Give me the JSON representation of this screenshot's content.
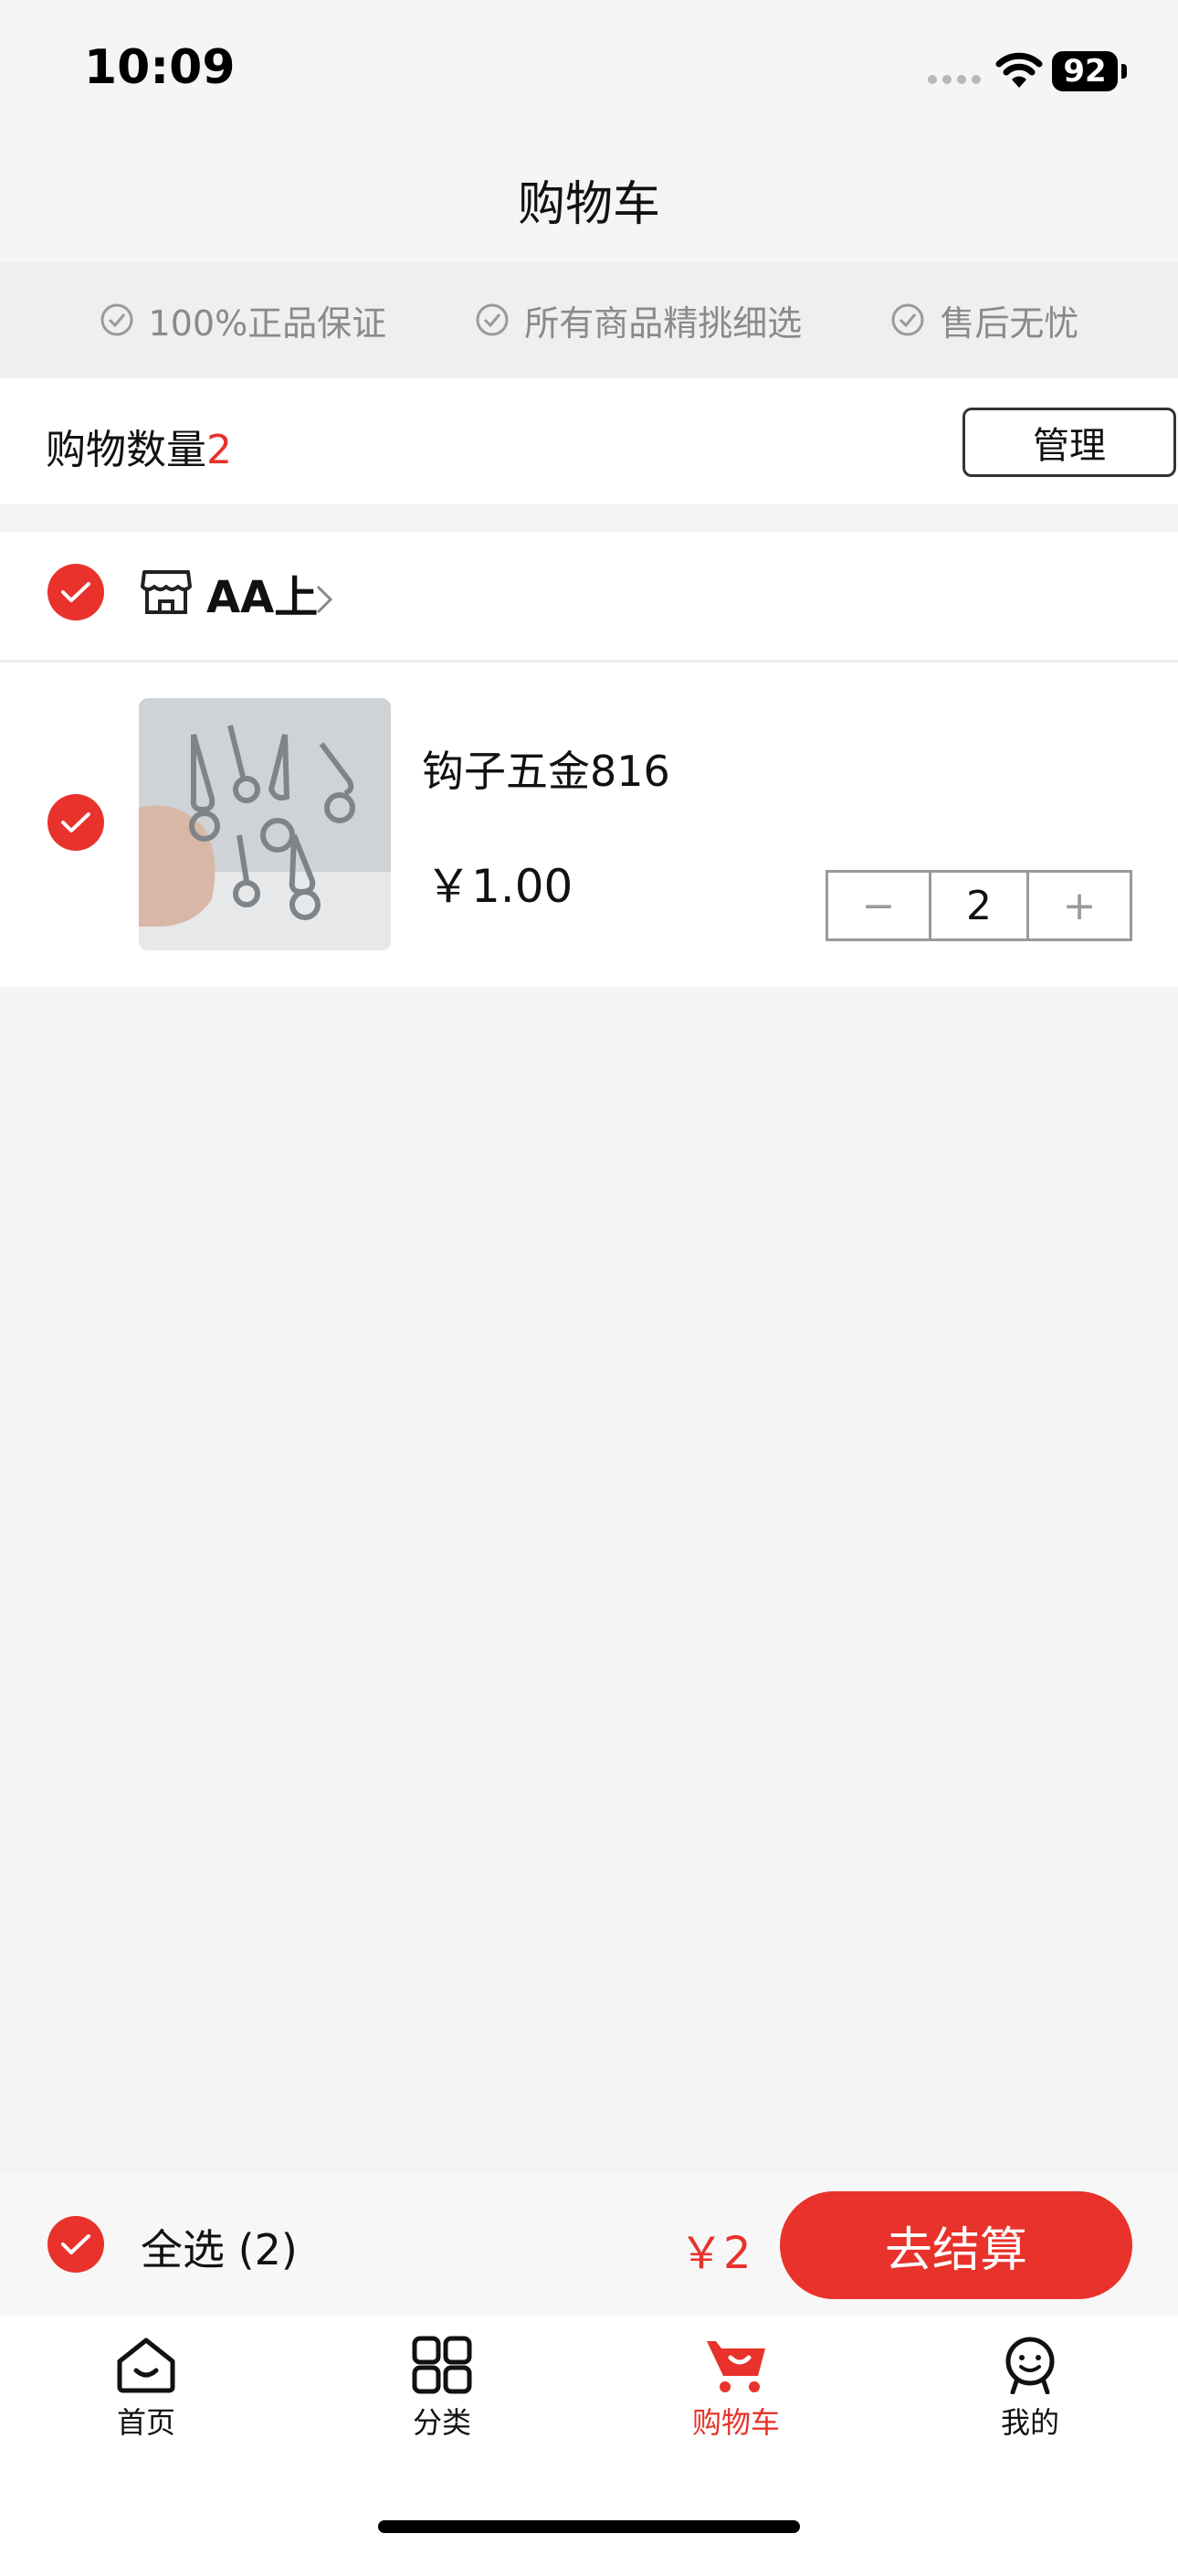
{
  "status_bar": {
    "time": "10:09",
    "battery": "92"
  },
  "nav": {
    "title": "购物车"
  },
  "guarantees": [
    {
      "label": "100%正品保证",
      "icon": "check-circle-icon"
    },
    {
      "label": "所有商品精挑细选",
      "icon": "check-circle-icon"
    },
    {
      "label": "售后无忧",
      "icon": "check-circle-icon"
    }
  ],
  "cart_count": {
    "label": "购物数量",
    "value": "2"
  },
  "manage_label": "管理",
  "store": {
    "name": "AA上",
    "item": {
      "name": "钩子五金816",
      "price": "￥1.00",
      "quantity": "2",
      "minus": "−",
      "plus": "+"
    }
  },
  "checkout": {
    "select_all": "全选 (2)",
    "total": "￥2",
    "pay_label": "去结算"
  },
  "tabs": [
    {
      "label": "首页",
      "icon": "home-icon"
    },
    {
      "label": "分类",
      "icon": "grid-icon"
    },
    {
      "label": "购物车",
      "icon": "cart-icon"
    },
    {
      "label": "我的",
      "icon": "profile-icon"
    }
  ],
  "colors": {
    "accent": "#e8322b",
    "background": "#f4f4f4"
  }
}
